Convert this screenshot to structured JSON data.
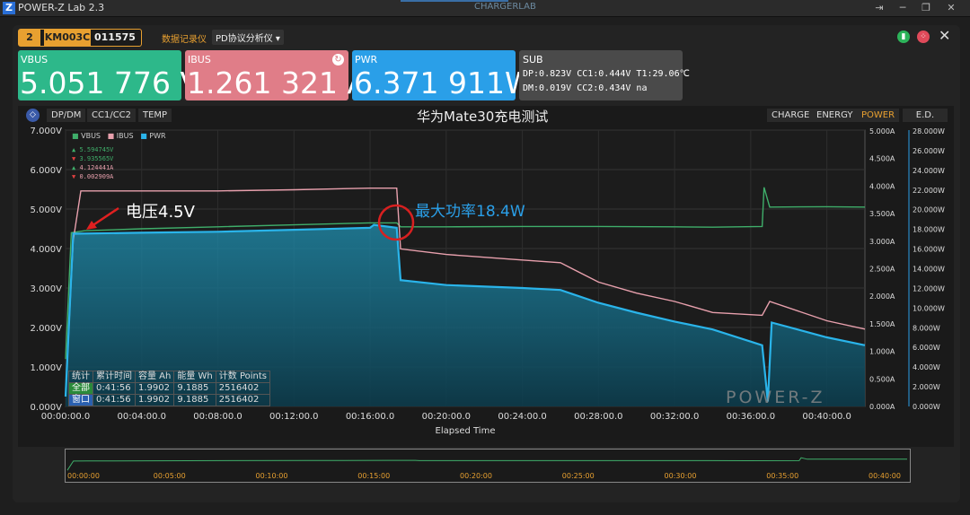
{
  "window": {
    "title": "POWER-Z Lab 2.3",
    "brand": "CHARGERLAB"
  },
  "device": {
    "index": "2",
    "model": "KM003C",
    "serial": "011575"
  },
  "menus": {
    "recorder": "数据记录仪",
    "pd": "PD协议分析仪"
  },
  "cards": {
    "vbus": {
      "label": "VBUS",
      "value": "5.051 776 V",
      "color": "#2db88a"
    },
    "ibus": {
      "label": "IBUS",
      "value": "1.261 321 A",
      "color": "#e07d88"
    },
    "pwr": {
      "label": "PWR",
      "value": "6.371 911W",
      "color": "#2a9fe8"
    }
  },
  "sub": {
    "label": "SUB",
    "row1": "DP:0.823V  CC1:0.444V  T1:29.06℃",
    "row2": "DM:0.019V  CC2:0.434V  na"
  },
  "chart_tabs_left": [
    "DP/DM",
    "CC1/CC2",
    "TEMP"
  ],
  "chart_tabs_right": [
    "CHARGE",
    "ENERGY",
    "POWER",
    "E.D."
  ],
  "chart_title": "华为Mate30充电测试",
  "legend": {
    "vbus": "VBUS",
    "ibus": "IBUS",
    "pwr": "PWR"
  },
  "markers": [
    "5.594745V",
    "3.935565V",
    "4.124441A",
    "0.002909A"
  ],
  "annotations": {
    "voltage": "电压4.5V",
    "maxpower": "最大功率18.4W"
  },
  "stats": {
    "headers": [
      "统计",
      "累计时间",
      "容量 Ah",
      "能量 Wh",
      "计数 Points"
    ],
    "rows": [
      [
        "全部",
        "0:41:56",
        "1.9902",
        "9.1885",
        "2516402"
      ],
      [
        "窗口",
        "0:41:56",
        "1.9902",
        "9.1885",
        "2516402"
      ]
    ]
  },
  "watermark": "POWER-Z",
  "chart_data": {
    "type": "line",
    "xlabel": "Elapsed Time",
    "x_ticks": [
      "00:00:00.0",
      "00:04:00.0",
      "00:08:00.0",
      "00:12:00.0",
      "00:16:00.0",
      "00:20:00.0",
      "00:24:00.0",
      "00:28:00.0",
      "00:32:00.0",
      "00:36:00.0",
      "00:40:00.0"
    ],
    "y_left_ticks": [
      "0.000V",
      "1.000V",
      "2.000V",
      "3.000V",
      "4.000V",
      "5.000V",
      "6.000V",
      "7.000V"
    ],
    "y_mid_ticks": [
      "0.000A",
      "0.500A",
      "1.000A",
      "1.500A",
      "2.000A",
      "2.500A",
      "3.000A",
      "3.500A",
      "4.000A",
      "4.500A",
      "5.000A"
    ],
    "y_right_ticks": [
      "0.000W",
      "2.000W",
      "4.000W",
      "6.000W",
      "8.000W",
      "10.000W",
      "12.000W",
      "14.000W",
      "16.000W",
      "18.000W",
      "20.000W",
      "22.000W",
      "24.000W",
      "26.000W",
      "28.000W"
    ],
    "xlim_min": [
      0,
      42
    ],
    "series": [
      {
        "name": "VBUS",
        "unit": "V",
        "ylim": [
          0,
          7
        ],
        "color": "#3fae6a",
        "points": [
          [
            0,
            1.2
          ],
          [
            0.3,
            4.4
          ],
          [
            1,
            4.45
          ],
          [
            4,
            4.5
          ],
          [
            8,
            4.55
          ],
          [
            12,
            4.6
          ],
          [
            16,
            4.65
          ],
          [
            17.4,
            4.65
          ],
          [
            17.6,
            4.55
          ],
          [
            20,
            4.55
          ],
          [
            24,
            4.56
          ],
          [
            28,
            4.56
          ],
          [
            32,
            4.55
          ],
          [
            34,
            4.54
          ],
          [
            36.6,
            4.56
          ],
          [
            36.7,
            5.55
          ],
          [
            37,
            5.05
          ],
          [
            40,
            5.06
          ],
          [
            42,
            5.05
          ]
        ]
      },
      {
        "name": "IBUS",
        "unit": "A",
        "ylim": [
          0,
          5
        ],
        "color": "#e8a0ad",
        "points": [
          [
            0,
            0.2
          ],
          [
            0.4,
            3.0
          ],
          [
            0.8,
            3.9
          ],
          [
            4,
            3.9
          ],
          [
            8,
            3.9
          ],
          [
            12,
            3.92
          ],
          [
            16,
            3.95
          ],
          [
            17.4,
            3.95
          ],
          [
            17.6,
            2.85
          ],
          [
            20,
            2.75
          ],
          [
            24,
            2.65
          ],
          [
            26,
            2.6
          ],
          [
            28,
            2.25
          ],
          [
            30,
            2.05
          ],
          [
            32,
            1.9
          ],
          [
            34,
            1.7
          ],
          [
            36.6,
            1.65
          ],
          [
            37,
            1.9
          ],
          [
            40,
            1.55
          ],
          [
            42,
            1.4
          ]
        ]
      },
      {
        "name": "PWR",
        "unit": "W",
        "ylim": [
          0,
          28
        ],
        "color": "#2ab4ea",
        "points": [
          [
            0,
            1.0
          ],
          [
            0.4,
            17.5
          ],
          [
            4,
            17.6
          ],
          [
            8,
            17.7
          ],
          [
            12,
            17.9
          ],
          [
            16,
            18.1
          ],
          [
            16.2,
            18.4
          ],
          [
            17.4,
            18.1
          ],
          [
            17.6,
            12.8
          ],
          [
            20,
            12.3
          ],
          [
            24,
            12.0
          ],
          [
            26,
            11.8
          ],
          [
            28,
            10.5
          ],
          [
            30,
            9.5
          ],
          [
            32,
            8.6
          ],
          [
            34,
            7.8
          ],
          [
            36.6,
            6.2
          ],
          [
            36.9,
            0.5
          ],
          [
            37.1,
            8.5
          ],
          [
            40,
            7.0
          ],
          [
            42,
            6.2
          ]
        ]
      }
    ],
    "grid": true
  },
  "overview": {
    "ticks": [
      "00:00:00",
      "00:05:00",
      "00:10:00",
      "00:15:00",
      "00:20:00",
      "00:25:00",
      "00:30:00",
      "00:35:00",
      "00:40:00"
    ]
  }
}
